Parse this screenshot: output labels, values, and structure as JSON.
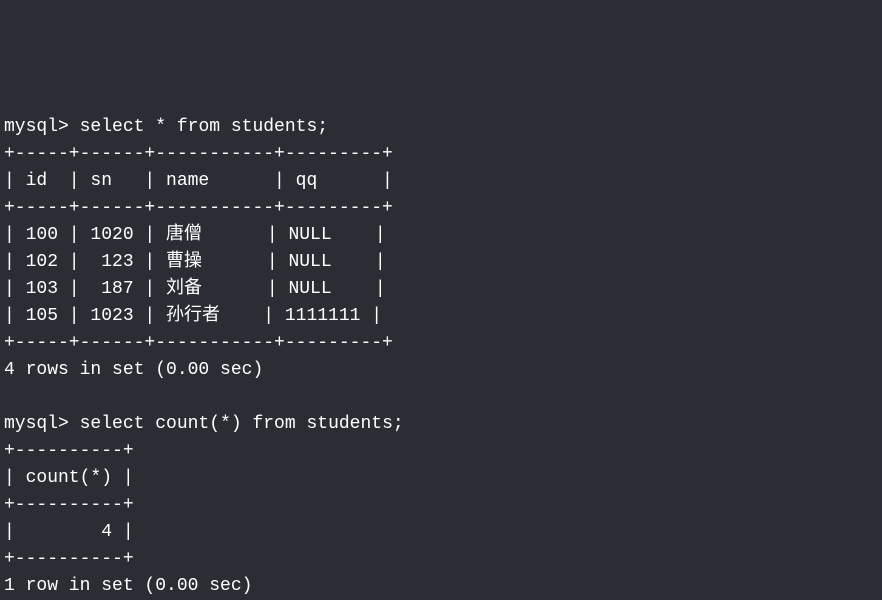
{
  "prompt_text": "mysql>",
  "query1": {
    "command": "select * from students;",
    "border_top": "+-----+------+-----------+---------+",
    "header_row": "| id  | sn   | name      | qq      |",
    "border_mid": "+-----+------+-----------+---------+",
    "table": {
      "columns": [
        "id",
        "sn",
        "name",
        "qq"
      ],
      "rows": [
        {
          "id": "100",
          "sn": "1020",
          "name": "唐僧",
          "qq": "NULL"
        },
        {
          "id": "102",
          "sn": "123",
          "name": "曹操",
          "qq": "NULL"
        },
        {
          "id": "103",
          "sn": "187",
          "name": "刘备",
          "qq": "NULL"
        },
        {
          "id": "105",
          "sn": "1023",
          "name": "孙行者",
          "qq": "1111111"
        }
      ]
    },
    "data_rows": [
      "| 100 | 1020 | 唐僧      | NULL    |",
      "| 102 |  123 | 曹操      | NULL    |",
      "| 103 |  187 | 刘备      | NULL    |",
      "| 105 | 1023 | 孙行者    | 1111111 |"
    ],
    "border_bot": "+-----+------+-----------+---------+",
    "result_msg": "4 rows in set (0.00 sec)"
  },
  "query2": {
    "command": "select count(*) from students;",
    "border_top": "+----------+",
    "header_row": "| count(*) |",
    "border_mid": "+----------+",
    "table": {
      "columns": [
        "count(*)"
      ],
      "rows": [
        {
          "count(*)": "4"
        }
      ]
    },
    "data_rows": [
      "|        4 |"
    ],
    "border_bot": "+----------+",
    "result_msg": "1 row in set (0.00 sec)"
  }
}
